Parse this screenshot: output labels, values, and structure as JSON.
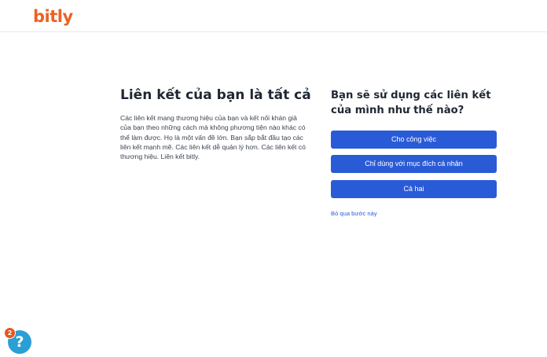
{
  "header": {
    "logo": "bitly"
  },
  "intro": {
    "headline": "Liên kết của bạn là tất cả",
    "body": "Các liên kết mang thương hiệu của bạn và kết nối khán giả của bạn theo những cách mà không phương tiện nào khác có thể làm được. Họ là một vấn đề lớn. Bạn sắp bắt đầu tạo các liên kết mạnh mẽ. Các liên kết dễ quản lý hơn. Các liên kết có thương hiệu. Liên kết bitly."
  },
  "survey": {
    "question": "Bạn sẽ sử dụng các liên kết của mình như thế nào?",
    "options": [
      {
        "label": "Cho công việc"
      },
      {
        "label": "Chỉ dùng với mục đích cá nhân"
      },
      {
        "label": "Cả hai"
      }
    ],
    "skip_label": "Bỏ qua bước này"
  },
  "help": {
    "icon": "question-mark-icon",
    "glyph": "?",
    "badge_count": "2",
    "colors": {
      "button": "#2a9fd6",
      "badge": "#e5561e"
    }
  },
  "colors": {
    "brand": "#ee6123",
    "primary": "#2a5bd7"
  }
}
